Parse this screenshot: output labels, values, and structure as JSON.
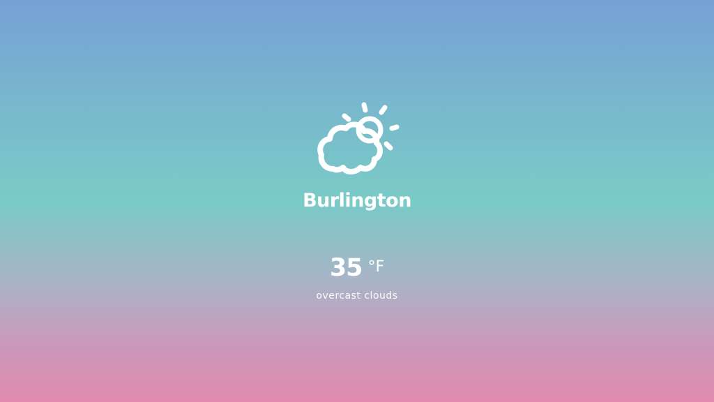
{
  "weather": {
    "icon": "partly-cloudy-icon",
    "city": "Burlington",
    "temperature": "35",
    "unit": "°F",
    "description": "overcast clouds"
  },
  "colors": {
    "background_top": "#76a0d6",
    "background_middle": "#7acbc7",
    "background_bottom": "#e18aaf",
    "text": "#ffffff"
  }
}
